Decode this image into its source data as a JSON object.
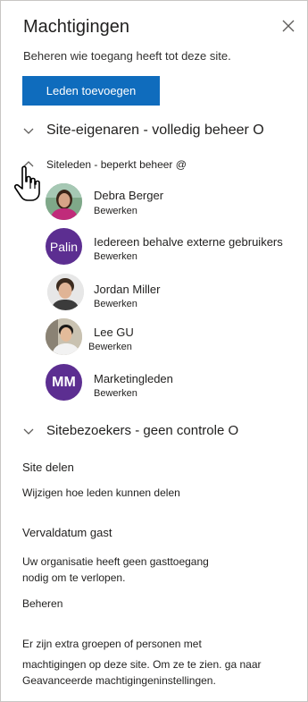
{
  "header": {
    "title": "Machtigingen",
    "subtitle": "Beheren wie toegang heeft tot deze site."
  },
  "actions": {
    "add_members_label": "Leden toevoegen"
  },
  "sections": {
    "owners_label": "Site-eigenaren - volledig beheer O",
    "members_label": "Siteleden - beperkt beheer @",
    "visitors_label": "Sitebezoekers - geen controle O"
  },
  "members": [
    {
      "name": "Debra Berger",
      "role": "Bewerken",
      "avatar": "photo"
    },
    {
      "name": "Iedereen behalve externe gebruikers",
      "role": "Bewerken",
      "avatar": "initials",
      "initials": "Palin",
      "color": "#5c2e91"
    },
    {
      "name": "Jordan Miller",
      "role": "Bewerken",
      "avatar": "photo"
    },
    {
      "name": "Lee GU",
      "role": "Bewerken",
      "avatar": "photo"
    },
    {
      "name": "Marketingleden",
      "role": "Bewerken",
      "avatar": "initials",
      "initials": "MM",
      "color": "#5c2e91"
    }
  ],
  "site_sharing": {
    "heading": "Site delen",
    "link": "Wijzigen hoe leden kunnen delen"
  },
  "guest_expiry": {
    "heading": "Vervaldatum gast",
    "line1": "Uw organisatie heeft geen gasttoegang",
    "line2": "nodig om te verlopen.",
    "manage": "Beheren"
  },
  "footer": {
    "line1": "Er zijn extra groepen of personen met",
    "line2": "machtigingen op deze site. Om ze te zien. ga naar",
    "line3": "Geavanceerde machtigingeninstellingen."
  },
  "colors": {
    "primary": "#0f6cbd",
    "group_avatar": "#5c2e91",
    "text": "#201f1e"
  },
  "icons": {
    "close": "close-icon",
    "collapse": "chevron-down-icon",
    "expand": "chevron-up-icon",
    "cursor": "hand-pointer-icon"
  }
}
